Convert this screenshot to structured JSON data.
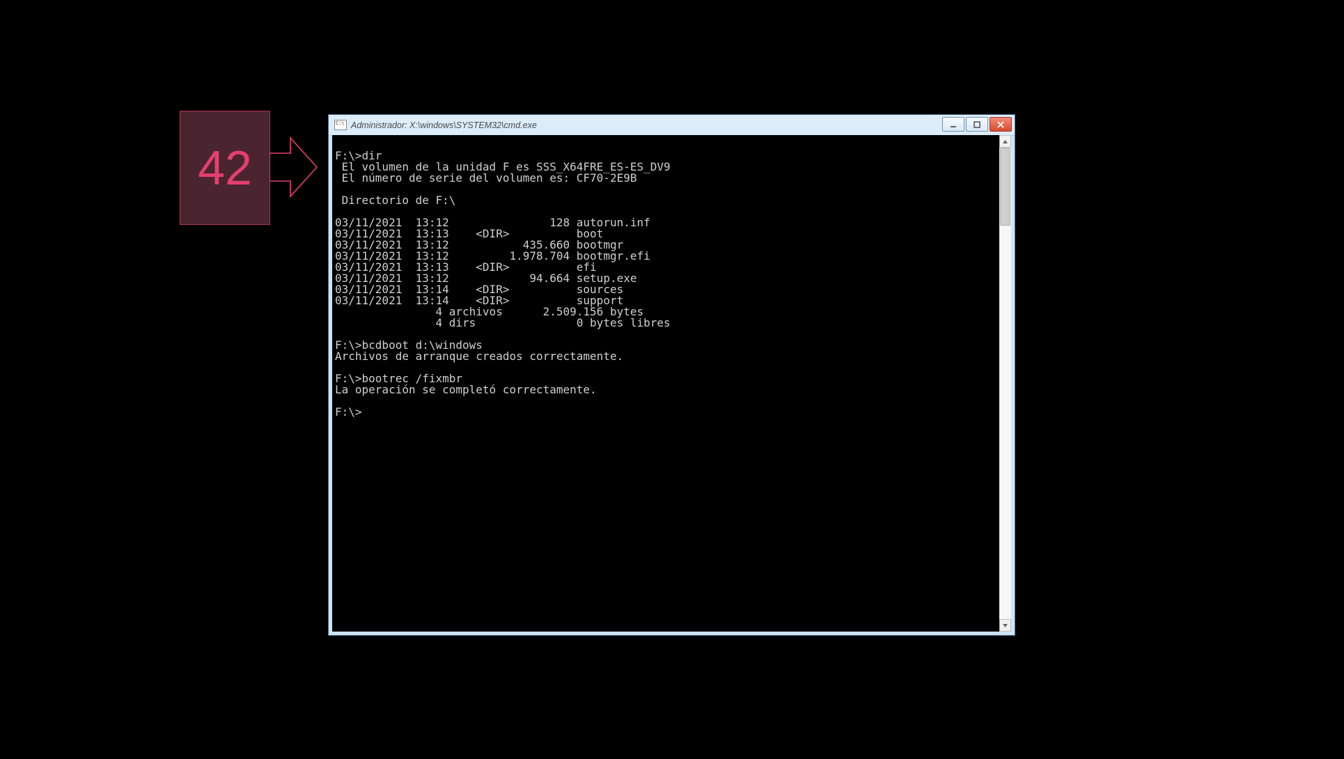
{
  "callout": {
    "number": "42",
    "colors": {
      "bg": "#4a2430",
      "border": "#b33353",
      "fg": "#e43f6f"
    }
  },
  "window": {
    "title": "Administrador: X:\\windows\\SYSTEM32\\cmd.exe",
    "buttons": {
      "min": "minimize",
      "max": "maximize",
      "close": "close"
    }
  },
  "terminal": {
    "lines": [
      "",
      "F:\\>dir",
      " El volumen de la unidad F es SSS_X64FRE_ES-ES_DV9",
      " El número de serie del volumen es: CF70-2E9B",
      "",
      " Directorio de F:\\",
      "",
      "03/11/2021  13:12               128 autorun.inf",
      "03/11/2021  13:13    <DIR>          boot",
      "03/11/2021  13:12           435.660 bootmgr",
      "03/11/2021  13:12         1.978.704 bootmgr.efi",
      "03/11/2021  13:13    <DIR>          efi",
      "03/11/2021  13:12            94.664 setup.exe",
      "03/11/2021  13:14    <DIR>          sources",
      "03/11/2021  13:14    <DIR>          support",
      "               4 archivos      2.509.156 bytes",
      "               4 dirs               0 bytes libres",
      "",
      "F:\\>bcdboot d:\\windows",
      "Archivos de arranque creados correctamente.",
      "",
      "F:\\>bootrec /fixmbr",
      "La operación se completó correctamente.",
      "",
      "F:\\>"
    ]
  }
}
